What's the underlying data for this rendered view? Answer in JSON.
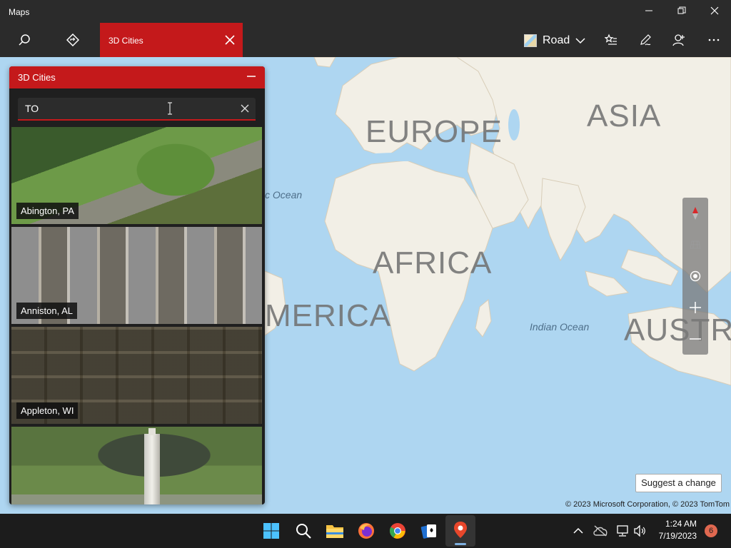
{
  "window": {
    "app_title": "Maps",
    "controls": [
      "minimize",
      "maximize",
      "close"
    ]
  },
  "toolbar": {
    "search_icon": "search-icon",
    "directions_icon": "directions-icon",
    "active_tab_label": "3D Cities",
    "map_style_label": "Road",
    "right_icons": [
      "favorites-icon",
      "ink-icon",
      "account-icon",
      "more-icon"
    ]
  },
  "panel": {
    "title": "3D Cities",
    "search": {
      "value": "TO",
      "placeholder": ""
    },
    "cities": [
      {
        "name": "Abington, PA"
      },
      {
        "name": "Anniston, AL"
      },
      {
        "name": "Appleton, WI"
      },
      {
        "name": ""
      }
    ]
  },
  "map": {
    "labels": {
      "europe": "EUROPE",
      "asia": "ASIA",
      "africa": "AFRICA",
      "america": "MERICA",
      "australia": "AUSTRA",
      "atlantic": "c Ocean",
      "indian": "Indian Ocean"
    },
    "suggest_change": "Suggest a change",
    "copyright": "© 2023 Microsoft Corporation, © 2023 TomTom",
    "colors": {
      "water": "#aed6f1",
      "land": "#f2efe6",
      "accent": "#c4191b"
    }
  },
  "taskbar": {
    "time": "1:24 AM",
    "date": "7/19/2023",
    "notification_count": "6"
  }
}
